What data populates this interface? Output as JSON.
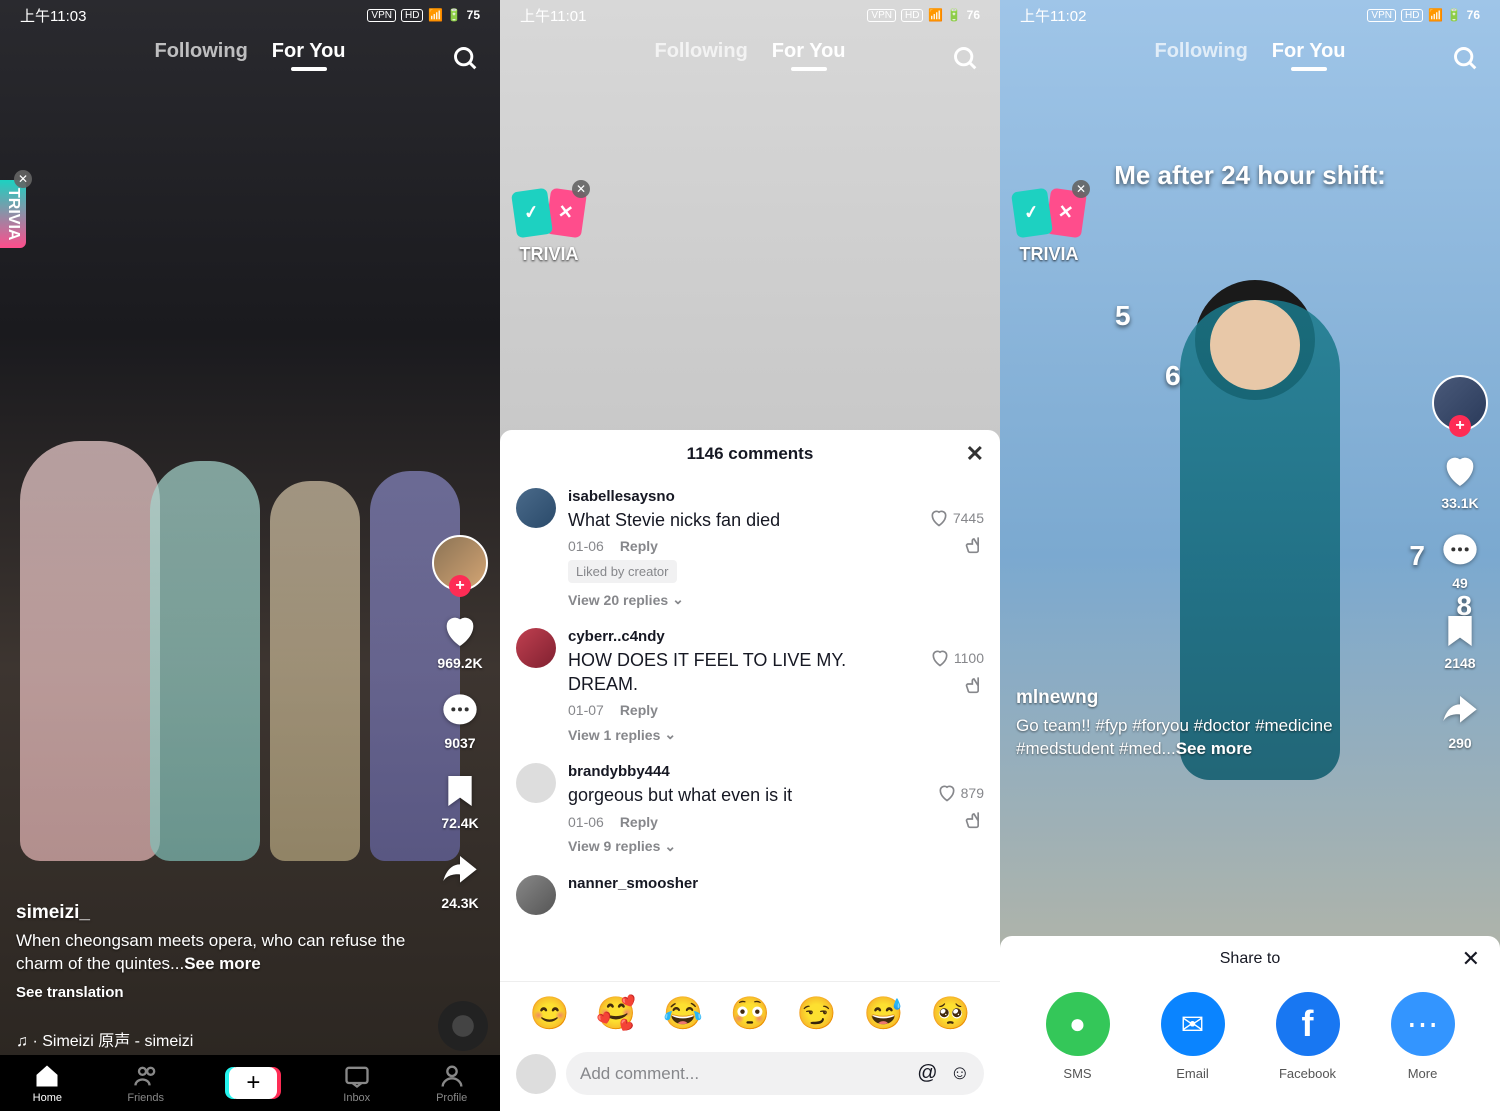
{
  "screens": [
    {
      "status": {
        "time": "上午11:03",
        "battery": "75",
        "indicators": [
          "VPN",
          "HD"
        ]
      },
      "tabs": {
        "following": "Following",
        "foryou": "For You"
      },
      "trivia_label": "TRIVIA",
      "rail": {
        "likes": "969.2K",
        "comments": "9037",
        "saves": "72.4K",
        "shares": "24.3K"
      },
      "info": {
        "username": "simeizi_",
        "caption": "When cheongsam meets opera, who can refuse the charm of the quintes...",
        "see_more": "See more",
        "translation": "See translation",
        "music": "♫ · Simeizi  原声 - simeizi"
      },
      "nav": {
        "home": "Home",
        "friends": "Friends",
        "inbox": "Inbox",
        "profile": "Profile"
      }
    },
    {
      "status": {
        "time": "上午11:01",
        "battery": "76",
        "indicators": [
          "VPN",
          "HD"
        ]
      },
      "tabs": {
        "following": "Following",
        "foryou": "For You"
      },
      "trivia_label": "TRIVIA",
      "comments": {
        "title": "1146 comments",
        "list": [
          {
            "user": "isabellesaysno",
            "text": "What Stevie nicks fan died",
            "date": "01-06",
            "reply": "Reply",
            "likes": "7445",
            "liked_by": "Liked by creator",
            "replies": "View 20 replies"
          },
          {
            "user": "cyberr..c4ndy",
            "text": "HOW DOES IT FEEL TO LIVE MY. DREAM.",
            "date": "01-07",
            "reply": "Reply",
            "likes": "1100",
            "replies": "View 1 replies"
          },
          {
            "user": "brandybby444",
            "text": "gorgeous but what even is it",
            "date": "01-06",
            "reply": "Reply",
            "likes": "879",
            "replies": "View 9 replies"
          },
          {
            "user": "nanner_smoosher",
            "text": "",
            "date": "",
            "reply": "",
            "likes": "",
            "replies": ""
          }
        ],
        "emojis": [
          "😊",
          "🥰",
          "😂",
          "😳",
          "😏",
          "😅",
          "🥺"
        ],
        "input_placeholder": "Add comment..."
      }
    },
    {
      "status": {
        "time": "上午11:02",
        "battery": "76",
        "indicators": [
          "VPN",
          "HD"
        ]
      },
      "tabs": {
        "following": "Following",
        "foryou": "For You"
      },
      "trivia_label": "TRIVIA",
      "overlay": {
        "text": "Me after 24 hour shift:",
        "nums": [
          "5",
          "6",
          "7",
          "8"
        ]
      },
      "rail": {
        "likes": "33.1K",
        "comments": "49",
        "saves": "2148",
        "shares": "290"
      },
      "info": {
        "username": "mlnewng",
        "caption": "Go team!! #fyp #foryou #doctor #medicine #medstudent #med...",
        "see_more": "See more"
      },
      "share": {
        "title": "Share to",
        "items": [
          {
            "label": "SMS",
            "color": "#34c759",
            "icon": "💬"
          },
          {
            "label": "Email",
            "color": "#0a84ff",
            "icon": "✉"
          },
          {
            "label": "Facebook",
            "color": "#1877f2",
            "icon": "f"
          },
          {
            "label": "More",
            "color": "#3395ff",
            "icon": "⋯"
          }
        ]
      }
    }
  ]
}
